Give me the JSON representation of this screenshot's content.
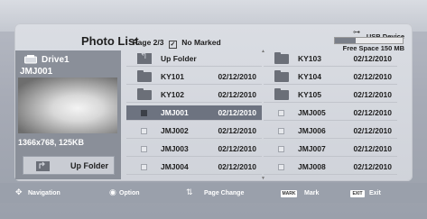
{
  "header": {
    "title": "Photo List",
    "page": "Page 2/3",
    "marked": "No Marked",
    "usb_device": "USB Device",
    "free_space": "Free Space 150 MB",
    "usb_fill_fraction": 0.3
  },
  "preview": {
    "drive": "Drive1",
    "file": "JMJ001",
    "resolution_size": "1366x768, 125KB",
    "up_folder_button": "Up Folder"
  },
  "files": [
    {
      "name": "Up Folder",
      "date": "",
      "kind": "up"
    },
    {
      "name": "KY103",
      "date": "02/12/2010",
      "kind": "folder"
    },
    {
      "name": "KY101",
      "date": "02/12/2010",
      "kind": "folder"
    },
    {
      "name": "KY104",
      "date": "02/12/2010",
      "kind": "folder"
    },
    {
      "name": "KY102",
      "date": "02/12/2010",
      "kind": "folder"
    },
    {
      "name": "KY105",
      "date": "02/12/2010",
      "kind": "folder"
    },
    {
      "name": "JMJ001",
      "date": "02/12/2010",
      "kind": "file",
      "selected": true
    },
    {
      "name": "JMJ005",
      "date": "02/12/2010",
      "kind": "file"
    },
    {
      "name": "JMJ002",
      "date": "02/12/2010",
      "kind": "file"
    },
    {
      "name": "JMJ006",
      "date": "02/12/2010",
      "kind": "file"
    },
    {
      "name": "JMJ003",
      "date": "02/12/2010",
      "kind": "file"
    },
    {
      "name": "JMJ007",
      "date": "02/12/2010",
      "kind": "file"
    },
    {
      "name": "JMJ004",
      "date": "02/12/2010",
      "kind": "file"
    },
    {
      "name": "JMJ008",
      "date": "02/12/2010",
      "kind": "file"
    }
  ],
  "help": {
    "navigation": "Navigation",
    "option": "Option",
    "page_change": "Page Change",
    "mark_key": "MARK",
    "mark": "Mark",
    "exit_key": "EXIT",
    "exit": "Exit"
  }
}
